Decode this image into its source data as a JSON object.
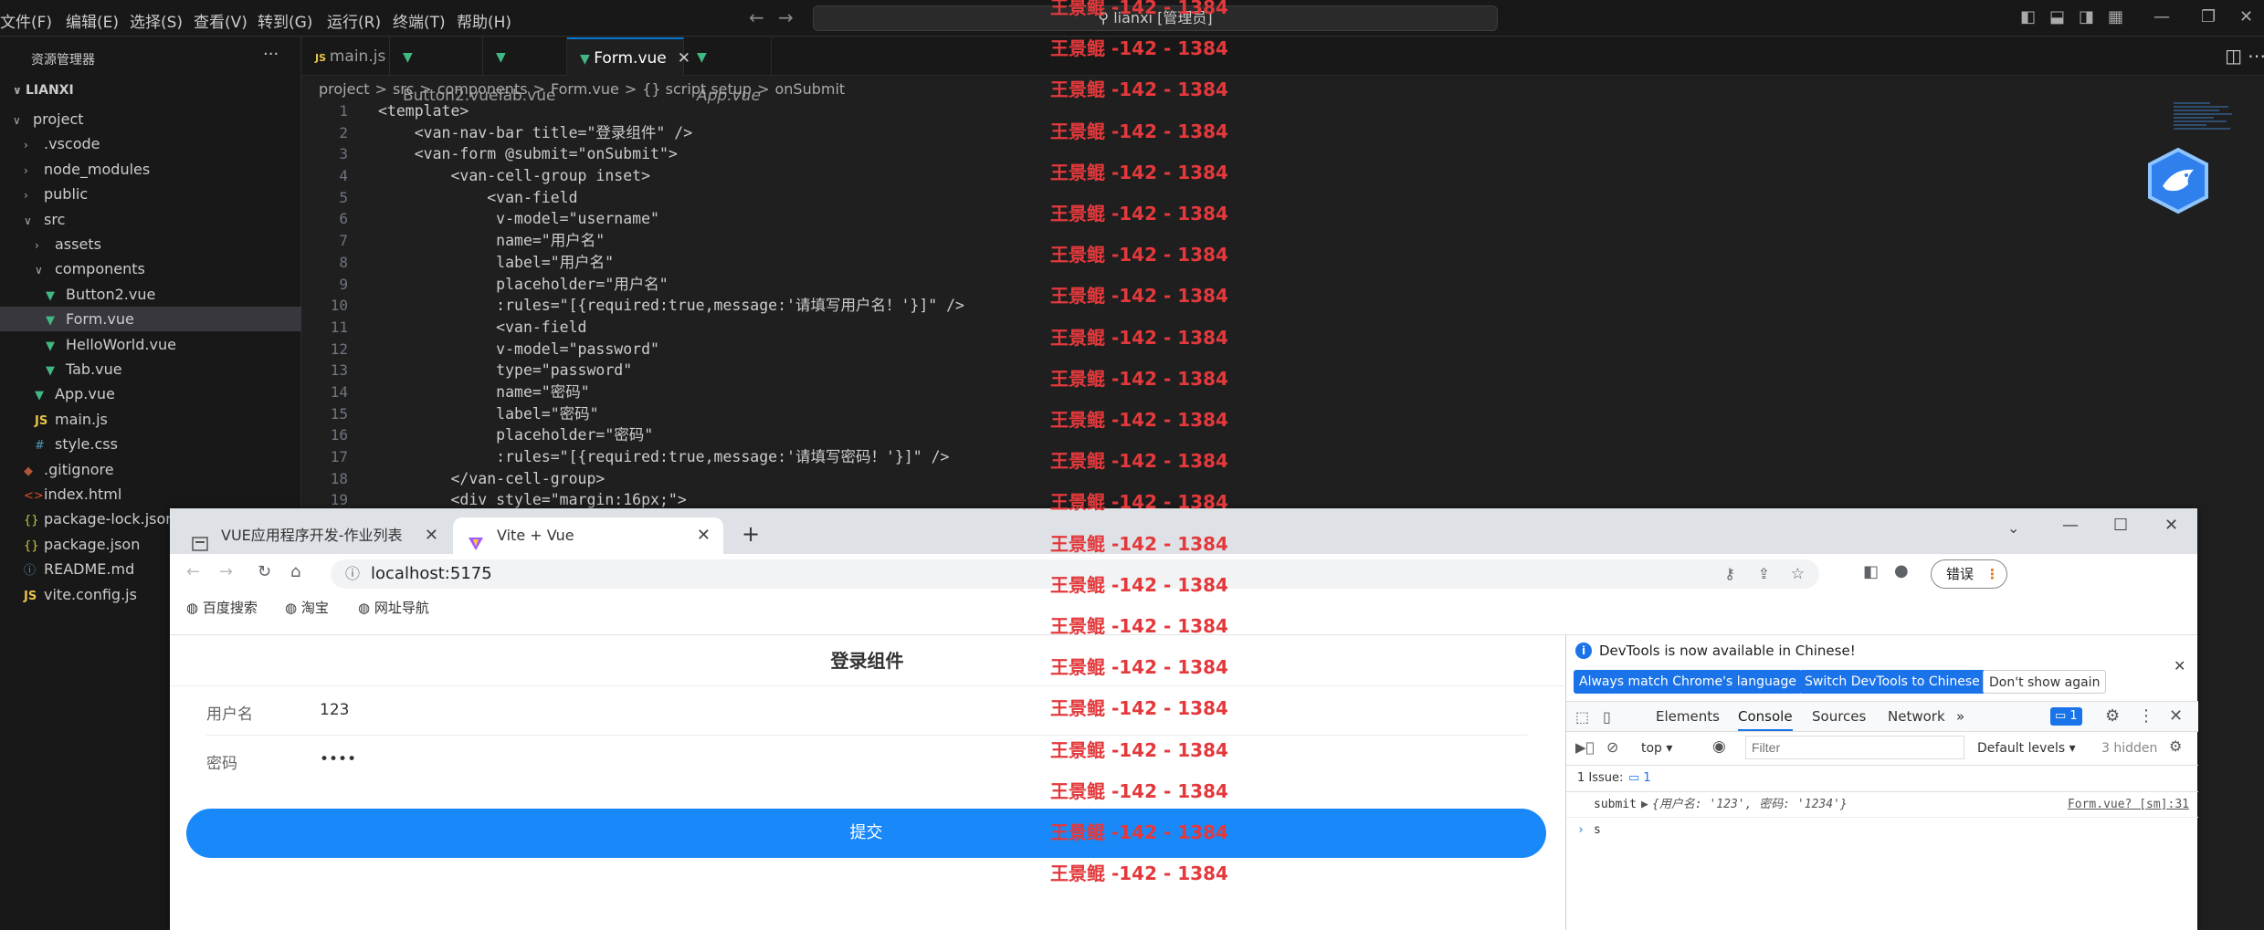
{
  "menu": [
    "文件(F)",
    "编辑(E)",
    "选择(S)",
    "查看(V)",
    "转到(G)",
    "运行(R)",
    "终端(T)",
    "帮助(H)"
  ],
  "command_center": "lianxi [管理员]",
  "explorer": {
    "title": "资源管理器",
    "more": "···",
    "root": "LIANXI",
    "items": [
      {
        "label": "project",
        "indent": 1,
        "kind": "folder-open"
      },
      {
        "label": ".vscode",
        "indent": 2,
        "kind": "folder"
      },
      {
        "label": "node_modules",
        "indent": 2,
        "kind": "folder"
      },
      {
        "label": "public",
        "indent": 2,
        "kind": "folder"
      },
      {
        "label": "src",
        "indent": 2,
        "kind": "folder-open"
      },
      {
        "label": "assets",
        "indent": 3,
        "kind": "folder"
      },
      {
        "label": "components",
        "indent": 3,
        "kind": "folder-open"
      },
      {
        "label": "Button2.vue",
        "indent": 4,
        "kind": "vue"
      },
      {
        "label": "Form.vue",
        "indent": 4,
        "kind": "vue",
        "selected": true
      },
      {
        "label": "HelloWorld.vue",
        "indent": 4,
        "kind": "vue"
      },
      {
        "label": "Tab.vue",
        "indent": 4,
        "kind": "vue"
      },
      {
        "label": "App.vue",
        "indent": 3,
        "kind": "vue"
      },
      {
        "label": "main.js",
        "indent": 3,
        "kind": "js"
      },
      {
        "label": "style.css",
        "indent": 3,
        "kind": "css"
      },
      {
        "label": ".gitignore",
        "indent": 2,
        "kind": "git"
      },
      {
        "label": "index.html",
        "indent": 2,
        "kind": "html"
      },
      {
        "label": "package-lock.json",
        "indent": 2,
        "kind": "json"
      },
      {
        "label": "package.json",
        "indent": 2,
        "kind": "json"
      },
      {
        "label": "README.md",
        "indent": 2,
        "kind": "info"
      },
      {
        "label": "vite.config.js",
        "indent": 2,
        "kind": "js"
      }
    ]
  },
  "editor_tabs": [
    {
      "label": "main.js",
      "kind": "js"
    },
    {
      "label": "Button2.vue",
      "kind": "vue"
    },
    {
      "label": "Tab.vue",
      "kind": "vue"
    },
    {
      "label": "Form.vue",
      "kind": "vue",
      "active": true,
      "close": "✕"
    },
    {
      "label": "App.vue",
      "kind": "vue",
      "italic": true
    }
  ],
  "breadcrumbs": [
    "project",
    ">",
    "src",
    ">",
    "components",
    ">",
    "Form.vue",
    ">",
    "{} script setup",
    ">",
    "onSubmit"
  ],
  "line_numbers": [
    "1",
    "2",
    "3",
    "4",
    "5",
    "6",
    "7",
    "8",
    "9",
    "10",
    "11",
    "12",
    "13",
    "14",
    "15",
    "16",
    "17",
    "18",
    "19"
  ],
  "code": [
    "<template>",
    "    <van-nav-bar title=\"登录组件\" />",
    "    <van-form @submit=\"onSubmit\">",
    "        <van-cell-group inset>",
    "            <van-field",
    "             v-model=\"username\"",
    "             name=\"用户名\"",
    "             label=\"用户名\"",
    "             placeholder=\"用户名\"",
    "             :rules=\"[{required:true,message:'请填写用户名！'}]\" />",
    "             <van-field",
    "             v-model=\"password\"",
    "             type=\"password\"",
    "             name=\"密码\"",
    "             label=\"密码\"",
    "             placeholder=\"密码\"",
    "             :rules=\"[{required:true,message:'请填写密码！'}]\" />",
    "        </van-cell-group>",
    "        <div style=\"margin:16px;\">"
  ],
  "watermark": "王景鲲 -142 - 1384",
  "browser": {
    "tabs": [
      {
        "label": "VUE应用程序开发-作业列表",
        "close": "✕"
      },
      {
        "label": "Vite + Vue",
        "close": "✕",
        "active": true
      }
    ],
    "new_tab": "+",
    "url": "localhost:5175",
    "error_button": "错误",
    "bookmarks": [
      "百度搜索",
      "淘宝",
      "网址导航"
    ],
    "page": {
      "title": "登录组件",
      "username_label": "用户名",
      "username_value": "123",
      "password_label": "密码",
      "password_value": "••••",
      "submit": "提交",
      "accent": "#1989fa"
    },
    "devtools": {
      "notice": "DevTools is now available in Chinese!",
      "btn_match": "Always match Chrome's language",
      "btn_switch": "Switch DevTools to Chinese",
      "btn_dont": "Don't show again",
      "tabs": [
        "Elements",
        "Console",
        "Sources",
        "Network"
      ],
      "more": "»",
      "badge": "1",
      "context": "top",
      "filter_placeholder": "Filter",
      "levels": "Default levels",
      "hidden": "3 hidden",
      "issues": "1 Issue:",
      "issues_count": "1",
      "log_label": "submit",
      "log_value": "{用户名: '123', 密码: '1234'}",
      "log_source": "Form.vue? [sm]:31",
      "prompt_input": "s"
    }
  }
}
